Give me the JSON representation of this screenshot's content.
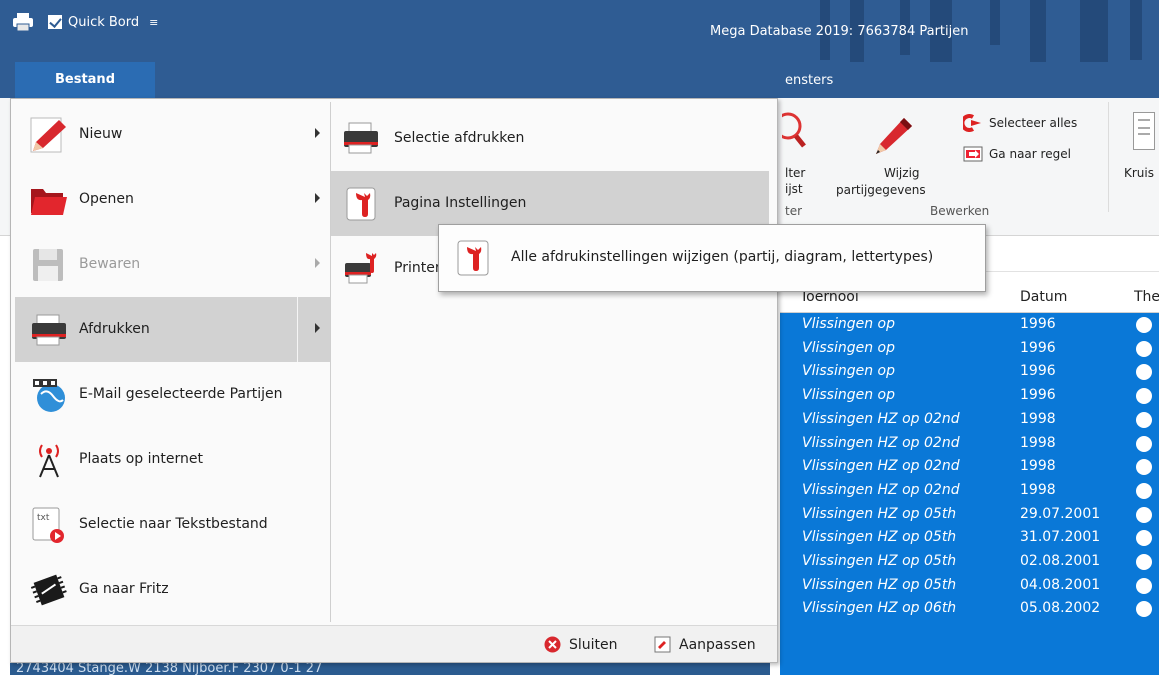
{
  "titlebar": {
    "quick_access_label": "Quick Bord",
    "app_title": "Mega Database 2019:  7663784 Partijen"
  },
  "ribbon": {
    "tab_partial": "ensters",
    "filter_top": "lter",
    "filter_bottom": "ijst",
    "filter_group": "ter",
    "edit_label_1": "Wijzig",
    "edit_label_2": "partijgegevens",
    "select_all": "Selecteer alles",
    "goto_row": "Ga naar regel",
    "group_edit": "Bewerken",
    "kruis": "Kruis"
  },
  "grid": {
    "headers": [
      "Toernooi",
      "Datum",
      "The"
    ],
    "rows": [
      {
        "event": "Vlissingen op",
        "date": "1996"
      },
      {
        "event": "Vlissingen op",
        "date": "1996"
      },
      {
        "event": "Vlissingen op",
        "date": "1996"
      },
      {
        "event": "Vlissingen op",
        "date": "1996"
      },
      {
        "event": "Vlissingen HZ op 02nd",
        "date": "1998"
      },
      {
        "event": "Vlissingen HZ op 02nd",
        "date": "1998"
      },
      {
        "event": "Vlissingen HZ op 02nd",
        "date": "1998"
      },
      {
        "event": "Vlissingen HZ op 02nd",
        "date": "1998"
      },
      {
        "event": "Vlissingen HZ op 05th",
        "date": "29.07.2001"
      },
      {
        "event": "Vlissingen HZ op 05th",
        "date": "31.07.2001"
      },
      {
        "event": "Vlissingen HZ op 05th",
        "date": "02.08.2001"
      },
      {
        "event": "Vlissingen HZ op 05th",
        "date": "04.08.2001"
      },
      {
        "event": "Vlissingen HZ op 06th",
        "date": "05.08.2002"
      }
    ],
    "bottom_stray": "2743404   Stange.W                    2138      Nijboer.F              2307         0-1              27"
  },
  "file_menu": {
    "tab_label": "Bestand",
    "items": [
      {
        "label": "Nieuw",
        "icon": "pencil-icon",
        "submenu": true
      },
      {
        "label": "Openen",
        "icon": "folder-icon",
        "submenu": true
      },
      {
        "label": "Bewaren",
        "icon": "floppy-disk-icon",
        "submenu": true,
        "disabled": true
      },
      {
        "label": "Afdrukken",
        "icon": "printer-icon",
        "submenu": true,
        "active": true
      },
      {
        "label": "E-Mail geselecteerde Partijen",
        "icon": "globe-mail-icon"
      },
      {
        "label": "Plaats op internet",
        "icon": "antenna-icon"
      },
      {
        "label": "Selectie naar Tekstbestand",
        "icon": "text-file-icon"
      },
      {
        "label": "Ga naar Fritz",
        "icon": "chip-icon"
      }
    ],
    "submenu": [
      {
        "label": "Selectie afdrukken",
        "icon": "printer-icon"
      },
      {
        "label": "Pagina Instellingen",
        "icon": "wrench-icon"
      },
      {
        "label": "Printer",
        "icon": "printer-wrench-icon"
      }
    ],
    "close_label": "Sluiten",
    "customize_label": "Aanpassen"
  },
  "tooltip": {
    "text": "Alle afdrukinstellingen wijzigen (partij, diagram, lettertypes)"
  }
}
